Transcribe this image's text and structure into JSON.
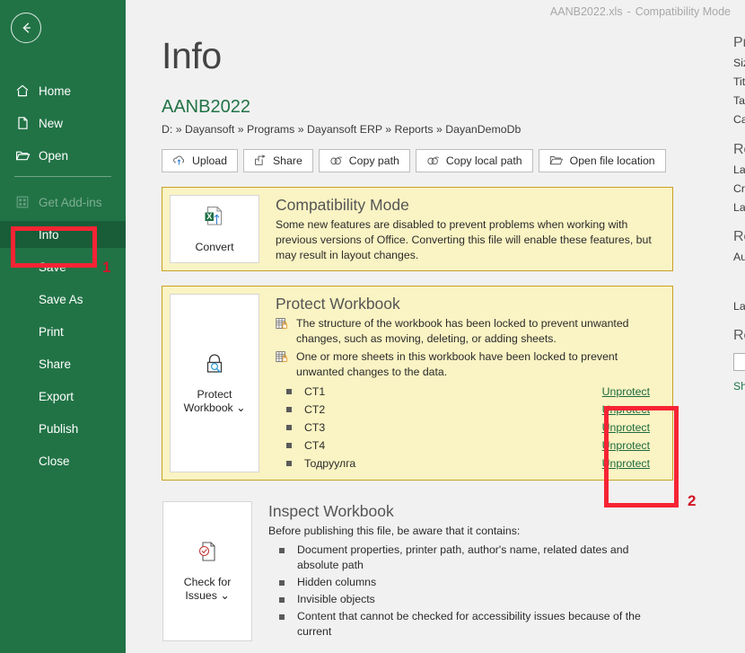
{
  "titlebar": {
    "file": "AANB2022.xls",
    "dash": "-",
    "mode": "Compatibility Mode"
  },
  "sidebar": {
    "back_label": "Back",
    "items": [
      {
        "label": "Home",
        "icon": "home-icon",
        "state": "normal"
      },
      {
        "label": "New",
        "icon": "page-icon",
        "state": "normal"
      },
      {
        "label": "Open",
        "icon": "folder-icon",
        "state": "normal"
      },
      {
        "label": "Get Add-ins",
        "icon": "add-ins-icon",
        "state": "disabled"
      },
      {
        "label": "Info",
        "icon": "",
        "state": "active"
      },
      {
        "label": "Save",
        "icon": "",
        "state": "normal"
      },
      {
        "label": "Save As",
        "icon": "",
        "state": "normal"
      },
      {
        "label": "Print",
        "icon": "",
        "state": "normal"
      },
      {
        "label": "Share",
        "icon": "",
        "state": "normal"
      },
      {
        "label": "Export",
        "icon": "",
        "state": "normal"
      },
      {
        "label": "Publish",
        "icon": "",
        "state": "normal"
      },
      {
        "label": "Close",
        "icon": "",
        "state": "normal"
      }
    ]
  },
  "main": {
    "page_title": "Info",
    "file_name": "AANB2022",
    "file_path": "D: » Dayansoft » Programs » Dayansoft ERP » Reports » DayanDemoDb",
    "path_buttons": [
      {
        "label": "Upload",
        "icon": "cloud-upload-icon"
      },
      {
        "label": "Share",
        "icon": "share-icon"
      },
      {
        "label": "Copy path",
        "icon": "link-icon"
      },
      {
        "label": "Copy local path",
        "icon": "link-icon"
      },
      {
        "label": "Open file location",
        "icon": "folder-open-icon"
      }
    ],
    "compatibility": {
      "button_label": "Convert",
      "button_icon": "excel-convert-icon",
      "title": "Compatibility Mode",
      "text": "Some new features are disabled to prevent problems when working with previous versions of Office. Converting this file will enable these features, but may result in layout changes."
    },
    "protect": {
      "button_label_line1": "Protect",
      "button_label_line2": "Workbook",
      "button_icon": "lock-key-icon",
      "button_caret": "⌄",
      "title": "Protect Workbook",
      "notes": [
        "The structure of the workbook has been locked to prevent unwanted changes, such as moving, deleting, or adding sheets.",
        "One or more sheets in this workbook have been locked to prevent unwanted changes to the data."
      ],
      "note_icon": "sheet-lock-icon",
      "sheets": [
        {
          "name": "CT1",
          "action": "Unprotect"
        },
        {
          "name": "CT2",
          "action": "Unprotect"
        },
        {
          "name": "CT3",
          "action": "Unprotect"
        },
        {
          "name": "CT4",
          "action": "Unprotect"
        },
        {
          "name": "Тодруулга",
          "action": "Unprotect"
        }
      ]
    },
    "inspect": {
      "button_label_line1": "Check for",
      "button_label_line2": "Issues",
      "button_icon": "inspect-doc-icon",
      "button_caret": "⌄",
      "title": "Inspect Workbook",
      "intro": "Before publishing this file, be aware that it contains:",
      "items": [
        "Document properties, printer path, author's name, related dates and absolute path",
        "Hidden columns",
        "Invisible objects",
        "Content that cannot be checked for accessibility issues because of the current"
      ]
    }
  },
  "right_rail": {
    "properties_heading": "Properties",
    "properties_labels": [
      "Size",
      "Title",
      "Tags",
      "Categories"
    ],
    "dates_heading": "Related Dates",
    "dates_labels": [
      "Last Modified",
      "Created",
      "Last Printed"
    ],
    "people_heading": "Related People",
    "people_labels": [
      "Author",
      "Last Modified By"
    ],
    "documents_heading": "Related Documents",
    "show_all": "Show All Properties"
  },
  "annotations": [
    {
      "id": "1",
      "label": "1",
      "target": "sidebar-item-info"
    },
    {
      "id": "2",
      "label": "2",
      "target": "unprotect-links"
    }
  ],
  "colors": {
    "sidebar_green": "#217346",
    "sidebar_active": "#195c38",
    "card_bg": "#faf3c3",
    "card_border": "#c8a225",
    "annotation_red": "#f62434",
    "link_green": "#1c6b3e"
  }
}
